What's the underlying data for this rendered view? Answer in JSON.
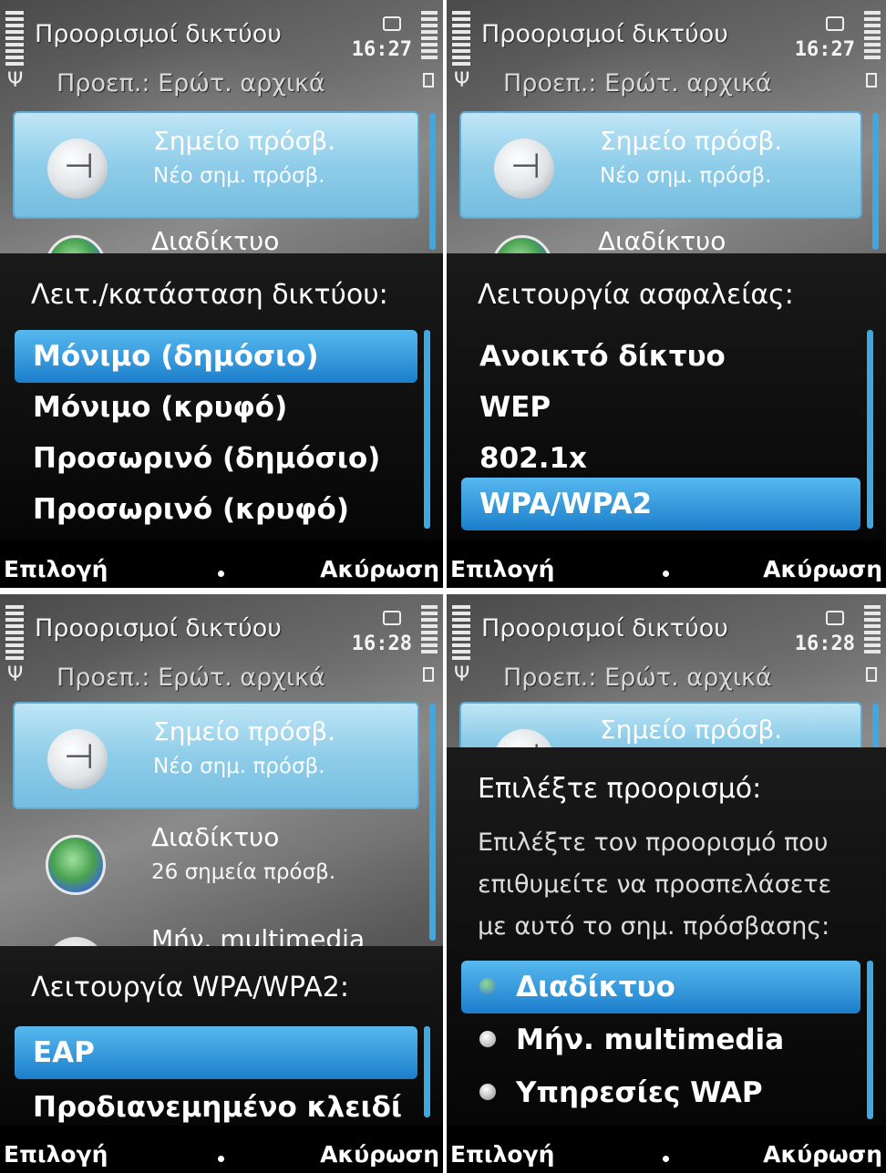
{
  "screens": [
    {
      "title": "Προορισμοί δικτύου",
      "time": "16:27",
      "subtitle": "Προεπ.: Ερώτ. αρχικά",
      "list": [
        {
          "title": "Σημείο πρόσβ.",
          "sub": "Νέο σημ. πρόσβ."
        },
        {
          "title": "Διαδίκτυο"
        }
      ],
      "popup": {
        "title": "Λειτ./κατάσταση δικτύου:",
        "options": [
          "Μόνιμο (δημόσιο)",
          "Μόνιμο (κρυφό)",
          "Προσωρινό (δημόσιο)",
          "Προσωρινό (κρυφό)"
        ],
        "selected": "Μόνιμο (δημόσιο)"
      },
      "softkeys": {
        "left": "Επιλογή",
        "right": "Ακύρωση"
      }
    },
    {
      "title": "Προορισμοί δικτύου",
      "time": "16:27",
      "subtitle": "Προεπ.: Ερώτ. αρχικά",
      "list": [
        {
          "title": "Σημείο πρόσβ.",
          "sub": "Νέο σημ. πρόσβ."
        },
        {
          "title": "Διαδίκτυο"
        }
      ],
      "popup": {
        "title": "Λειτουργία ασφαλείας:",
        "options": [
          "Ανοικτό δίκτυο",
          "WEP",
          "802.1x",
          "WPA/WPA2"
        ],
        "selected": "WPA/WPA2"
      },
      "softkeys": {
        "left": "Επιλογή",
        "right": "Ακύρωση"
      }
    },
    {
      "title": "Προορισμοί δικτύου",
      "time": "16:28",
      "subtitle": "Προεπ.: Ερώτ. αρχικά",
      "list": [
        {
          "title": "Σημείο πρόσβ.",
          "sub": "Νέο σημ. πρόσβ."
        },
        {
          "title": "Διαδίκτυο",
          "sub": "26 σημεία πρόσβ."
        },
        {
          "title": "Μήν. multimedia"
        }
      ],
      "popup": {
        "title": "Λειτουργία WPA/WPA2:",
        "options": [
          "EAP",
          "Προδιανεμημένο κλειδί"
        ],
        "selected": "EAP"
      },
      "softkeys": {
        "left": "Επιλογή",
        "right": "Ακύρωση"
      }
    },
    {
      "title": "Προορισμοί δικτύου",
      "time": "16:28",
      "subtitle": "Προεπ.: Ερώτ. αρχικά",
      "list": [
        {
          "title": "Σημείο πρόσβ."
        }
      ],
      "popup": {
        "title": "Επιλέξτε προορισμό:",
        "body": "Επιλέξτε τον προορισμό που επιθυμείτε να προσπελάσετε με αυτό το σημ. πρόσβασης:",
        "options": [
          "Διαδίκτυο",
          "Μήν. multimedia",
          "Υπηρεσίες WAP"
        ],
        "option_icons": [
          "globe-icon",
          "mms-icon",
          "wap-icon"
        ],
        "selected": "Διαδίκτυο"
      },
      "softkeys": {
        "left": "Επιλογή",
        "right": "Ακύρωση"
      }
    }
  ],
  "colors": {
    "selection": "#1c7ecb",
    "highlight_item": "#8fcde9",
    "scrollbar": "#3fa8e0"
  }
}
